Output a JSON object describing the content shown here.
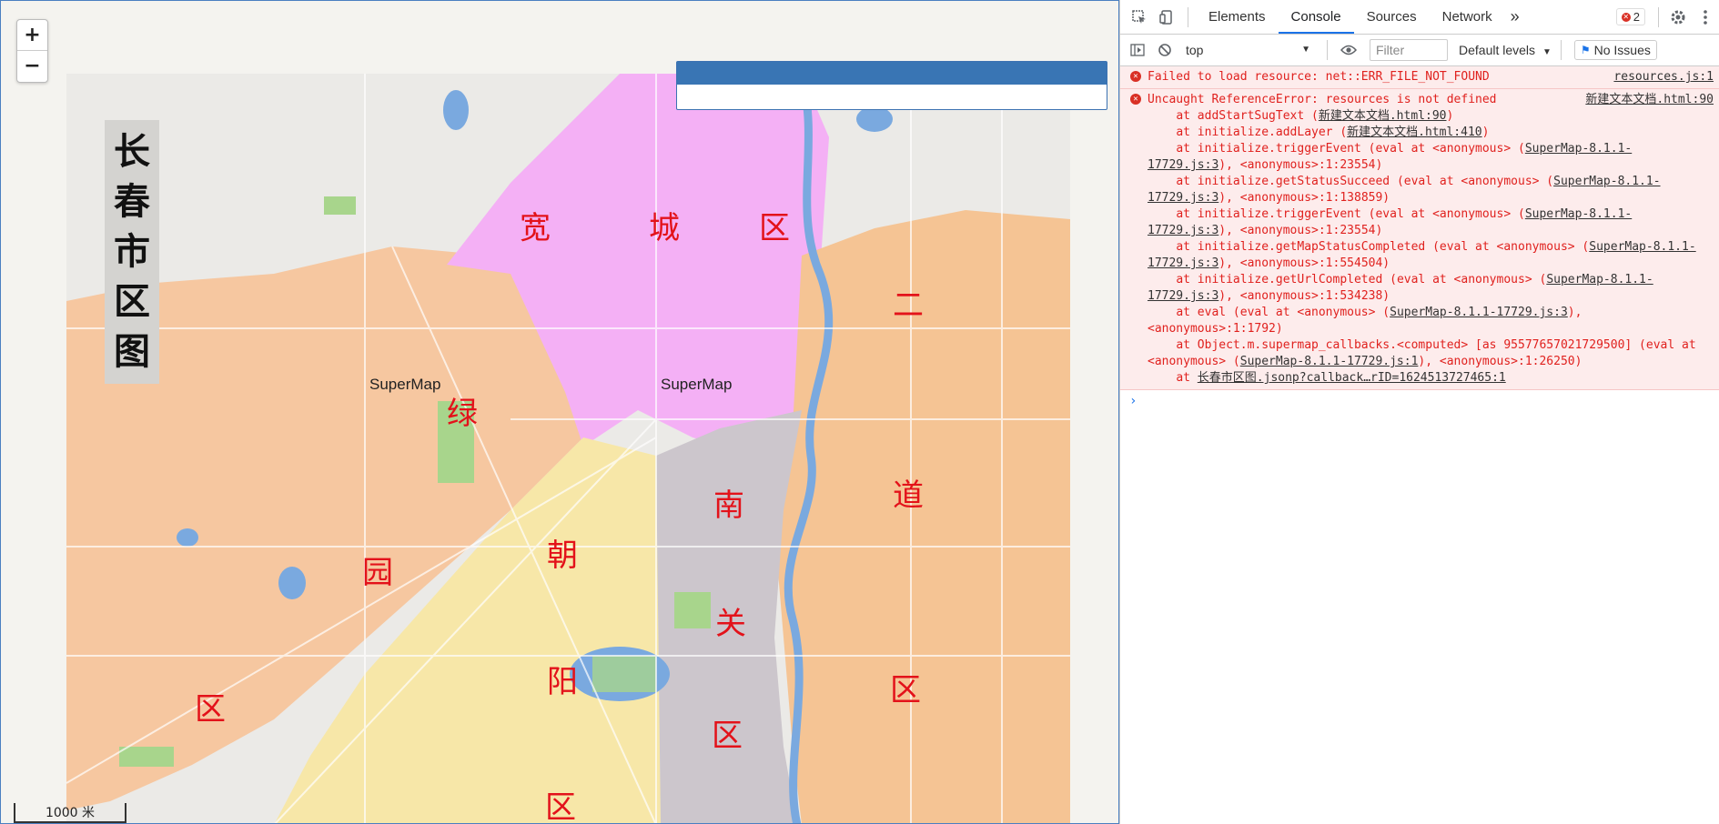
{
  "map": {
    "zoom_in": "+",
    "zoom_out": "−",
    "title_chars": [
      "长",
      "春",
      "市",
      "区",
      "图"
    ],
    "watermarks": [
      "SuperMap",
      "SuperMap"
    ],
    "district_chars": [
      "宽",
      "城",
      "区",
      "二",
      "道",
      "区",
      "绿",
      "园",
      "区",
      "朝",
      "阳",
      "区",
      "南",
      "关",
      "区"
    ],
    "scale_label": "1000 米",
    "colors": {
      "kuancheng": "#f4b0f5",
      "erdao": "#f5c494",
      "lvyuan": "#f6c7a0",
      "chaoyang": "#f7e7a8",
      "nanguan": "#ccc6cc",
      "water": "#7aa9df",
      "park": "#a8d58c",
      "background": "#ebeae7",
      "label": "#e3121a"
    }
  },
  "devtools": {
    "tabs": [
      "Elements",
      "Console",
      "Sources",
      "Network"
    ],
    "more": "»",
    "error_count": "2",
    "context": "top",
    "filter_placeholder": "Filter",
    "levels": "Default levels",
    "issues": "No Issues",
    "messages": [
      {
        "text": "Failed to load resource: net::ERR_FILE_NOT_FOUND",
        "source": "resources.js:1"
      },
      {
        "text": "Uncaught ReferenceError: resources is not defined",
        "source": "新建文本文档.html:90"
      }
    ],
    "stack": [
      [
        "    at addStartSugText (",
        "新建文本文档.html:90",
        ")"
      ],
      [
        "    at initialize.addLayer (",
        "新建文本文档.html:410",
        ")"
      ],
      [
        "    at initialize.triggerEvent (eval at <anonymous> (",
        "SuperMap-8.1.1-17729.js:3",
        "), <anonymous>:1:23554)"
      ],
      [
        "    at initialize.getStatusSucceed (eval at <anonymous> (",
        "SuperMap-8.1.1-17729.js:3",
        "), <anonymous>:1:138859)"
      ],
      [
        "    at initialize.triggerEvent (eval at <anonymous> (",
        "SuperMap-8.1.1-17729.js:3",
        "), <anonymous>:1:23554)"
      ],
      [
        "    at initialize.getMapStatusCompleted (eval at <anonymous> (",
        "SuperMap-8.1.1-17729.js:3",
        "), <anonymous>:1:554504)"
      ],
      [
        "    at initialize.getUrlCompleted (eval at <anonymous> (",
        "SuperMap-8.1.1-17729.js:3",
        "), <anonymous>:1:534238)"
      ],
      [
        "    at eval (eval at <anonymous> (",
        "SuperMap-8.1.1-17729.js:3",
        "), <anonymous>:1:1792)"
      ],
      [
        "    at Object.m.supermap_callbacks.<computed> [as 955776570217295​00] (eval at <anonymous> (",
        "SuperMap-8.1.1-17729.js:1",
        "), <anonymous>:1:26250)"
      ],
      [
        "    at ",
        "长春市区图.jsonp?callback…rID=1624513727465:1",
        ""
      ]
    ],
    "prompt": "›"
  }
}
